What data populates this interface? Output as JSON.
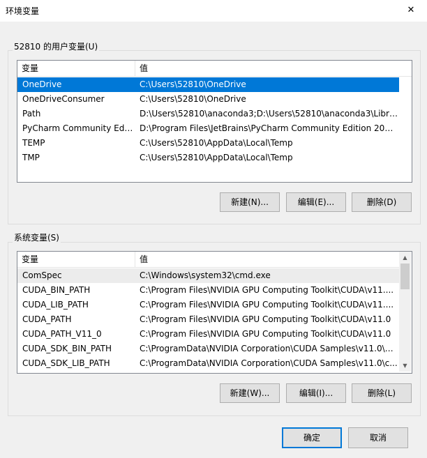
{
  "window": {
    "title": "环境变量",
    "close_glyph": "✕"
  },
  "user_vars": {
    "group_label": "52810 的用户变量(U)",
    "headers": {
      "name": "变量",
      "value": "值"
    },
    "rows": [
      {
        "name": "OneDrive",
        "value": "C:\\Users\\52810\\OneDrive"
      },
      {
        "name": "OneDriveConsumer",
        "value": "C:\\Users\\52810\\OneDrive"
      },
      {
        "name": "Path",
        "value": "D:\\Users\\52810\\anaconda3;D:\\Users\\52810\\anaconda3\\Libra..."
      },
      {
        "name": "PyCharm Community Editi...",
        "value": "D:\\Program Files\\JetBrains\\PyCharm Community Edition 2020..."
      },
      {
        "name": "TEMP",
        "value": "C:\\Users\\52810\\AppData\\Local\\Temp"
      },
      {
        "name": "TMP",
        "value": "C:\\Users\\52810\\AppData\\Local\\Temp"
      }
    ],
    "buttons": {
      "new": "新建(N)...",
      "edit": "编辑(E)...",
      "delete": "删除(D)"
    }
  },
  "system_vars": {
    "group_label": "系统变量(S)",
    "headers": {
      "name": "变量",
      "value": "值"
    },
    "rows": [
      {
        "name": "ComSpec",
        "value": "C:\\Windows\\system32\\cmd.exe"
      },
      {
        "name": "CUDA_BIN_PATH",
        "value": "C:\\Program Files\\NVIDIA GPU Computing Toolkit\\CUDA\\v11...."
      },
      {
        "name": "CUDA_LIB_PATH",
        "value": "C:\\Program Files\\NVIDIA GPU Computing Toolkit\\CUDA\\v11...."
      },
      {
        "name": "CUDA_PATH",
        "value": "C:\\Program Files\\NVIDIA GPU Computing Toolkit\\CUDA\\v11.0"
      },
      {
        "name": "CUDA_PATH_V11_0",
        "value": "C:\\Program Files\\NVIDIA GPU Computing Toolkit\\CUDA\\v11.0"
      },
      {
        "name": "CUDA_SDK_BIN_PATH",
        "value": "C:\\ProgramData\\NVIDIA Corporation\\CUDA Samples\\v11.0\\b..."
      },
      {
        "name": "CUDA_SDK_LIB_PATH",
        "value": "C:\\ProgramData\\NVIDIA Corporation\\CUDA Samples\\v11.0\\c..."
      }
    ],
    "buttons": {
      "new": "新建(W)...",
      "edit": "编辑(I)...",
      "delete": "删除(L)"
    }
  },
  "dialog_buttons": {
    "ok": "确定",
    "cancel": "取消"
  },
  "colors": {
    "selection": "#0078d7",
    "highlight": "#ececec"
  },
  "icons": {
    "scroll_up": "scroll-up-arrow-icon",
    "scroll_down": "scroll-down-arrow-icon"
  }
}
